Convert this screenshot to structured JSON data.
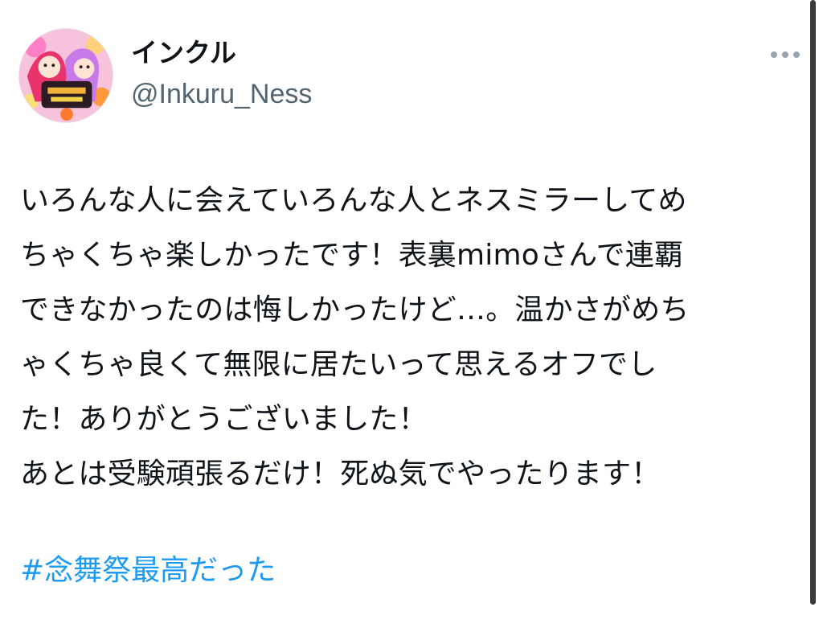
{
  "tweet": {
    "display_name": "インクル",
    "handle": "@Inkuru_Ness",
    "body_lines": [
      "いろんな人に会えていろんな人とネスミラーしてめ",
      "ちゃくちゃ楽しかったです！表裏mimoさんで連覇",
      "できなかったのは悔しかったけど…。温かさがめち",
      "ゃくちゃ良くて無限に居たいって思えるオフでし",
      "た！ありがとうございました！",
      "あとは受験頑張るだけ！死ぬ気でやったります！"
    ],
    "hashtag": "#念舞祭最高だった"
  },
  "icons": {
    "more": "more-horizontal-icon",
    "avatar": "avatar-illustration"
  },
  "colors": {
    "text": "#0f1419",
    "handle": "#536471",
    "hashtag": "#1d9bf0",
    "more_dots": "#9aa5b0",
    "background": "#ffffff"
  }
}
